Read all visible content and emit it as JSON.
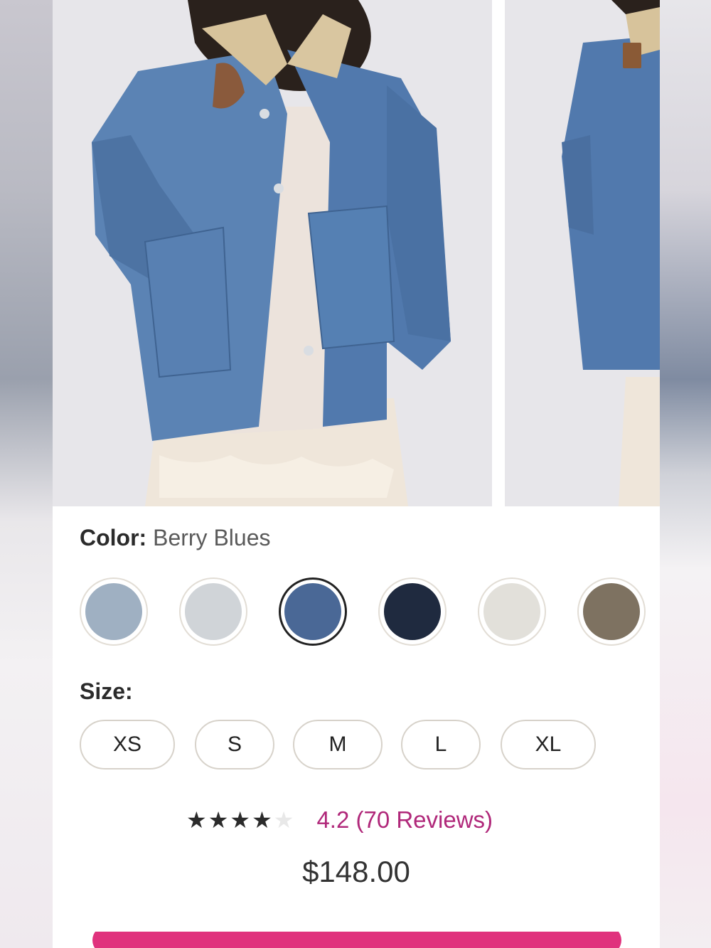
{
  "product": {
    "color_label": "Color:",
    "color_value": "Berry Blues",
    "swatches": [
      {
        "name": "light-wash",
        "color": "#9fb0c2"
      },
      {
        "name": "pale-wash",
        "color": "#d0d4d8"
      },
      {
        "name": "berry-blues",
        "color": "#4a6896",
        "selected": true
      },
      {
        "name": "dark-navy",
        "color": "#1f2a3f"
      },
      {
        "name": "ecru",
        "color": "#e2e0da"
      },
      {
        "name": "brown",
        "color": "#7e7261"
      }
    ],
    "size_label": "Size:",
    "sizes": [
      "XS",
      "S",
      "M",
      "L",
      "XL"
    ],
    "rating_stars": "★★★★",
    "rating_empty_star": "★",
    "rating_text": "4.2 (70 Reviews)",
    "rating_value": 4.2,
    "price": "$148.00"
  },
  "colors": {
    "cta": "#e0327d",
    "rating_accent": "#b0287a",
    "denim": "#4e79ab",
    "collar": "#d9c49b"
  }
}
